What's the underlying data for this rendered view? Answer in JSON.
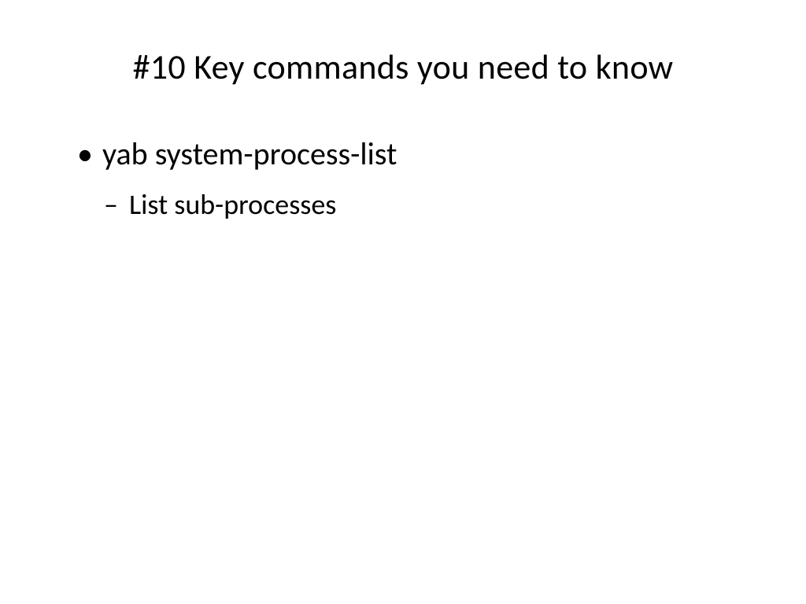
{
  "slide": {
    "title": "#10 Key commands you need to know",
    "bullets": [
      {
        "text": "yab system-process-list",
        "sub_bullets": [
          "List sub-processes"
        ]
      }
    ]
  }
}
